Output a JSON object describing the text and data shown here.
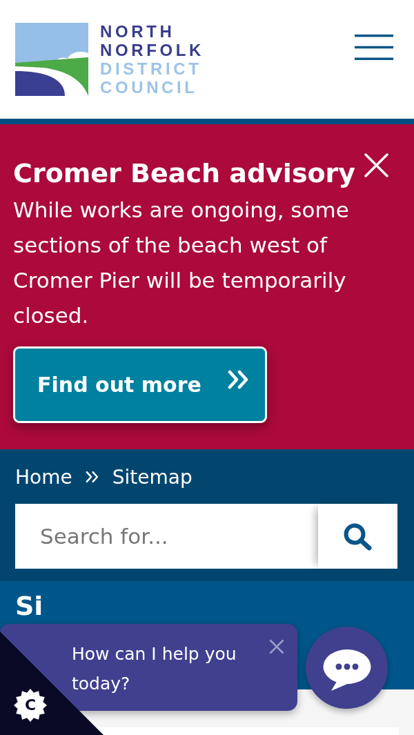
{
  "header": {
    "logo": {
      "name_lines": [
        "NORTH",
        "NORFOLK"
      ],
      "subtitle_lines": [
        "DISTRICT",
        "COUNCIL"
      ]
    }
  },
  "alert": {
    "title": "Cromer Beach advisory",
    "message": "While works are ongoing, some sections of the beach west of Cromer Pier will be temporarily closed.",
    "button": "Find out more"
  },
  "breadcrumb": [
    "Home",
    "Sitemap"
  ],
  "search": {
    "placeholder": "Search for..."
  },
  "page_heading": "Si",
  "chat": {
    "prompt": "How can I help you today?"
  },
  "cookie_button": {
    "label": "C"
  }
}
